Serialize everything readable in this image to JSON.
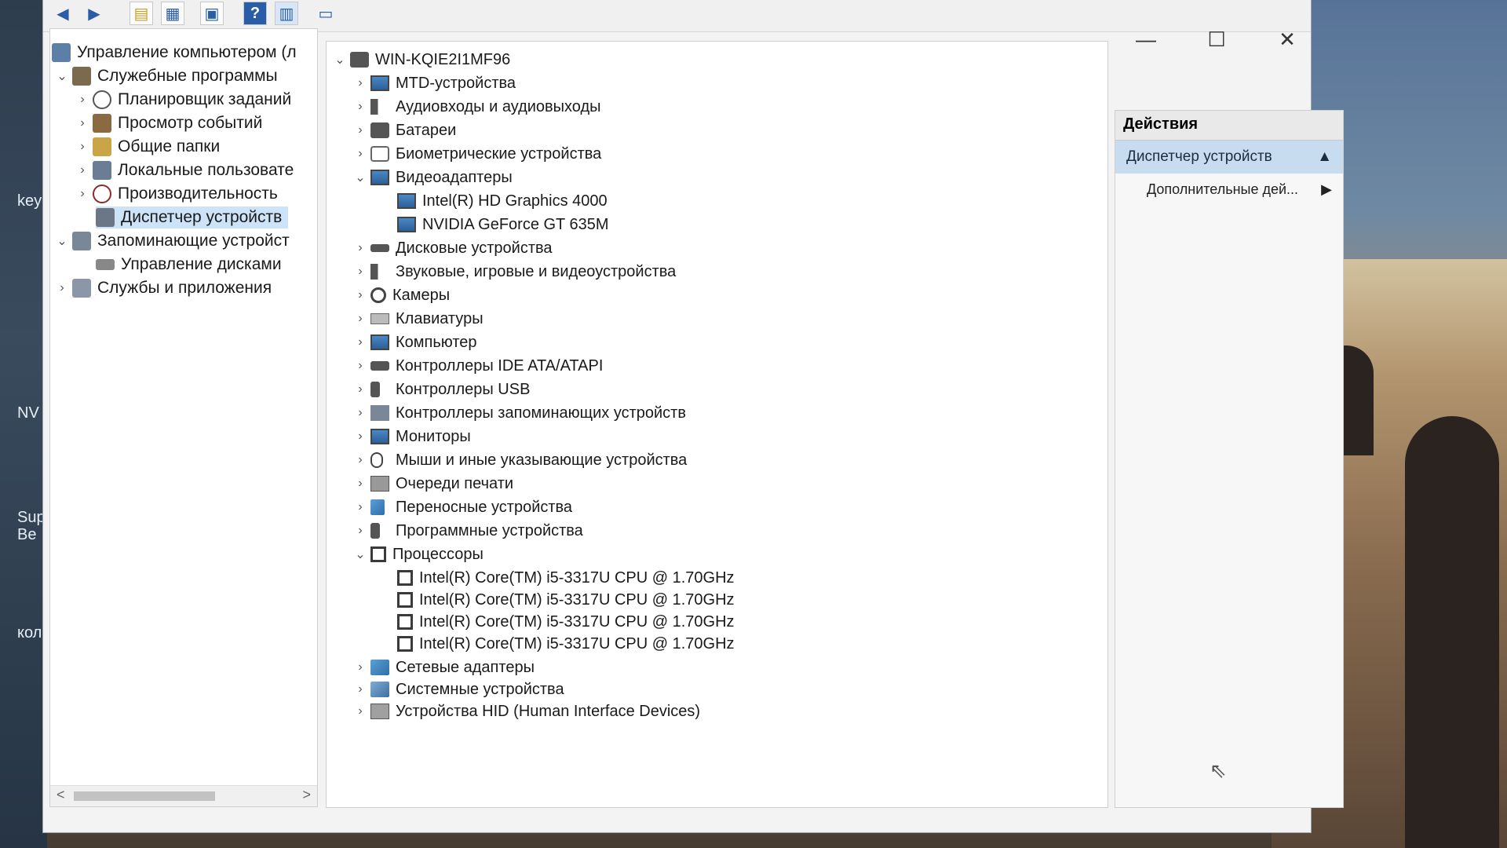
{
  "desktop": {
    "labels": [
      "key",
      "NV",
      "Sup",
      "Be",
      "кол"
    ],
    "colors": {
      "sky": "#6f8fb4",
      "stone": "#a98a62"
    }
  },
  "toolbar": {
    "icons": [
      "back-arrow-icon",
      "forward-arrow-icon",
      "folder-up-icon",
      "show-hide-tree-icon",
      "properties-icon",
      "help-icon",
      "action-pane-icon",
      "monitor-icon"
    ],
    "help_glyph": "?"
  },
  "window_controls": {
    "minimize": "—",
    "maximize": "☐",
    "close": "✕"
  },
  "left_tree": {
    "root": "Управление компьютером (л",
    "utilities": "Служебные программы",
    "scheduler": "Планировщик заданий",
    "event_viewer": "Просмотр событий",
    "shared_folders": "Общие папки",
    "local_users": "Локальные пользовате",
    "performance": "Производительность",
    "device_manager": "Диспетчер устройств",
    "storage": "Запоминающие устройст",
    "disk_management": "Управление дисками",
    "services": "Службы и приложения",
    "scroll_left": "<",
    "scroll_right": ">"
  },
  "device_tree": {
    "computer_name": "WIN-KQIE2I1MF96",
    "categories": {
      "mtd": "MTD-устройства",
      "audio_io": "Аудиовходы и аудиовыходы",
      "batteries": "Батареи",
      "biometric": "Биометрические устройства",
      "video": "Видеоадаптеры",
      "disk": "Дисковые устройства",
      "sound": "Звуковые, игровые и видеоустройства",
      "cameras": "Камеры",
      "keyboards": "Клавиатуры",
      "computer": "Компьютер",
      "ide": "Контроллеры IDE ATA/ATAPI",
      "usb": "Контроллеры USB",
      "storage_ctrl": "Контроллеры запоминающих устройств",
      "monitors": "Мониторы",
      "mice": "Мыши и иные указывающие устройства",
      "print_queues": "Очереди печати",
      "portable": "Переносные устройства",
      "software": "Программные устройства",
      "processors": "Процессоры",
      "network": "Сетевые адаптеры",
      "system": "Системные устройства",
      "hid": "Устройства HID (Human Interface Devices)"
    },
    "video_adapters": [
      "Intel(R) HD Graphics 4000",
      "NVIDIA GeForce GT 635M"
    ],
    "processors": [
      "Intel(R) Core(TM) i5-3317U CPU @ 1.70GHz",
      "Intel(R) Core(TM) i5-3317U CPU @ 1.70GHz",
      "Intel(R) Core(TM) i5-3317U CPU @ 1.70GHz",
      "Intel(R) Core(TM) i5-3317U CPU @ 1.70GHz"
    ],
    "expand_glyph": ">",
    "collapse_glyph": "v"
  },
  "actions": {
    "header": "Действия",
    "section": "Диспетчер устройств",
    "section_arrow": "▲",
    "more": "Дополнительные дей...",
    "more_arrow": "▶"
  }
}
